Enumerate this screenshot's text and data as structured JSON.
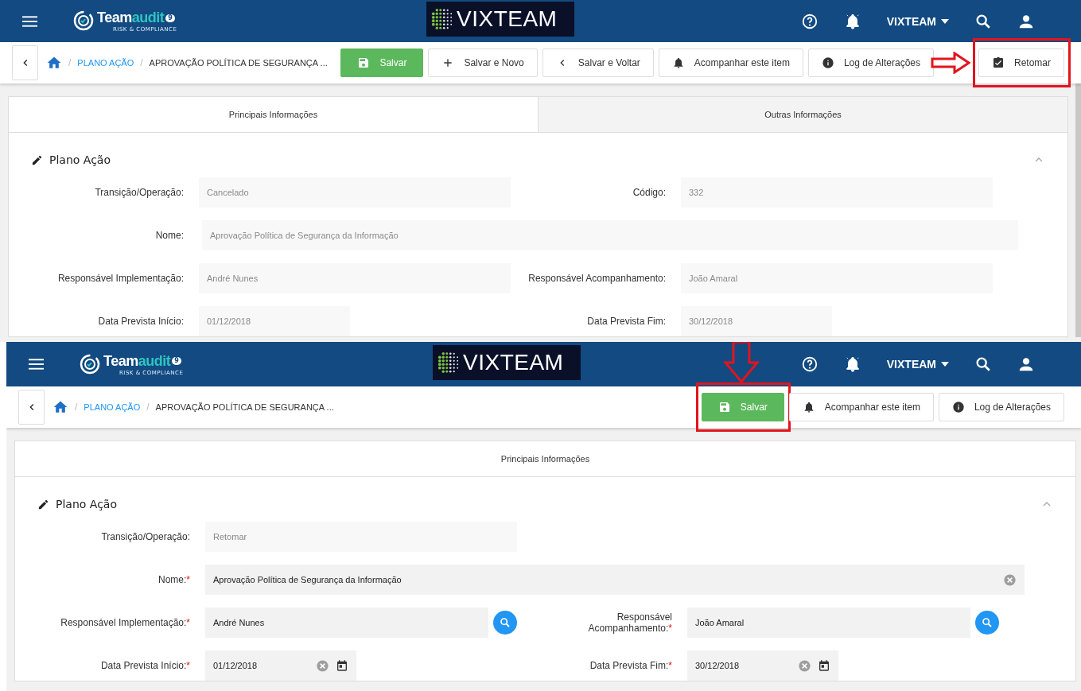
{
  "screens": [
    {
      "header": {
        "brand_main": "Team",
        "brand_accent": "audit",
        "brand_badge": "9",
        "brand_tagline": "RISK & COMPLIANCE",
        "center_logo": "VIXTEAM",
        "user": "VIXTEAM"
      },
      "breadcrumb": [
        {
          "separator": "/",
          "label": "PLANO AÇÃO",
          "kind": "link"
        },
        {
          "separator": "/",
          "label": "APROVAÇÃO POLÍTICA DE SEGURANÇA ...",
          "kind": "current"
        }
      ],
      "actions": [
        {
          "label": "Salvar",
          "kind": "save",
          "highlighted": false
        },
        {
          "label": "Salvar e Novo",
          "kind": "add",
          "highlighted": false
        },
        {
          "label": "Salvar e Voltar",
          "kind": "back",
          "highlighted": false
        },
        {
          "label": "Acompanhar este item",
          "kind": "follow",
          "highlighted": false
        },
        {
          "label": "Log de Alterações",
          "kind": "log",
          "highlighted": false
        },
        {
          "label": "Retomar",
          "kind": "resume",
          "highlighted": true,
          "callout_arrow": {
            "kind": "right"
          }
        }
      ],
      "tabs": [
        {
          "label": "Principais Informações",
          "selected": true
        },
        {
          "label": "Outras Informações",
          "selected": false
        }
      ],
      "section": {
        "title": "Plano Ação",
        "expanded": true
      },
      "editable": false,
      "rows": [
        {
          "kind": "pair",
          "fields": [
            {
              "label": "Transição/Operação:",
              "value": "Cancelado",
              "kind": "text"
            },
            {
              "label": "Código:",
              "value": "332",
              "kind": "text"
            }
          ]
        },
        {
          "kind": "full",
          "fields": [
            {
              "label": "Nome:",
              "value": "Aprovação Política de Segurança da Informação",
              "kind": "text"
            }
          ]
        },
        {
          "kind": "pair",
          "fields": [
            {
              "label": "Responsável Implementação:",
              "value": "André Nunes",
              "kind": "lookup"
            },
            {
              "label": "Responsável Acompanhamento:",
              "value": "João Amaral",
              "kind": "lookup"
            }
          ]
        },
        {
          "kind": "pair",
          "fields": [
            {
              "label": "Data Prevista Início:",
              "value": "01/12/2018",
              "kind": "date"
            },
            {
              "label": "Data Prevista Fim:",
              "value": "30/12/2018",
              "kind": "date"
            }
          ]
        }
      ]
    },
    {
      "header": {
        "brand_main": "Team",
        "brand_accent": "audit",
        "brand_badge": "9",
        "brand_tagline": "RISK & COMPLIANCE",
        "center_logo": "VIXTEAM",
        "user": "VIXTEAM"
      },
      "breadcrumb": [
        {
          "separator": "/",
          "label": "PLANO AÇÃO",
          "kind": "link"
        },
        {
          "separator": "/",
          "label": "APROVAÇÃO POLÍTICA DE SEGURANÇA ...",
          "kind": "current"
        }
      ],
      "actions": [
        {
          "label": "Salvar",
          "kind": "save",
          "highlighted": true,
          "callout_arrow": {
            "kind": "down"
          }
        },
        {
          "label": "Acompanhar este item",
          "kind": "follow",
          "highlighted": false
        },
        {
          "label": "Log de Alterações",
          "kind": "log",
          "highlighted": false
        }
      ],
      "tabs": [
        {
          "label": "Principais Informações",
          "selected": true
        }
      ],
      "section": {
        "title": "Plano Ação",
        "expanded": true
      },
      "editable": true,
      "rows": [
        {
          "kind": "pair",
          "fields": [
            {
              "label": "Transição/Operação:",
              "value": "Retomar",
              "kind": "text",
              "locked": true
            }
          ]
        },
        {
          "kind": "full",
          "fields": [
            {
              "label": "Nome:",
              "required_mark": "*",
              "value": "Aprovação Política de Segurança da Informação",
              "kind": "text",
              "clearable": true
            }
          ]
        },
        {
          "kind": "pair",
          "fields": [
            {
              "label": "Responsável Implementação:",
              "required_mark": "*",
              "value": "André Nunes",
              "kind": "lookup"
            },
            {
              "label": "Responsável Acompanhamento:",
              "required_mark": "*",
              "value": "João Amaral",
              "kind": "lookup"
            }
          ]
        },
        {
          "kind": "pair",
          "fields": [
            {
              "label": "Data Prevista Início:",
              "required_mark": "*",
              "value": "01/12/2018",
              "kind": "date",
              "clearable": true
            },
            {
              "label": "Data Prevista Fim:",
              "required_mark": "*",
              "value": "30/12/2018",
              "kind": "date",
              "clearable": true
            }
          ]
        }
      ]
    }
  ]
}
